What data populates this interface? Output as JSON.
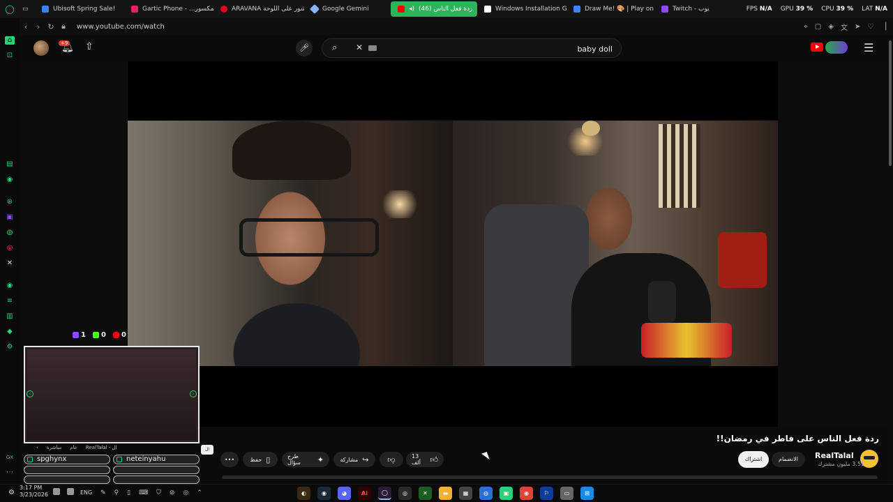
{
  "browser": {
    "tabs": [
      {
        "label": "Ubisoft Spring Sale!",
        "color": "#3b82f6"
      },
      {
        "label": "Gartic Phone - ...لف المكسور",
        "color": "#e91e63"
      },
      {
        "label": "ARAVANA منشور على اللوحة",
        "color": "#e60023"
      },
      {
        "label": "Google Gemini",
        "color": "#8ab4f8"
      },
      {
        "label": "(46) ردة فعل الناس",
        "color": "#ff0000",
        "active": true
      },
      {
        "label": "Windows Installation Guid",
        "color": "#ffffff"
      },
      {
        "label": "Draw Me! 🎨 | Play on Rob",
        "color": "#3b82f6"
      },
      {
        "label": "Twitch - يوب",
        "color": "#9146ff"
      }
    ],
    "url": "www.youtube.com/watch",
    "stats": {
      "fps_label": "FPS",
      "fps_value": "N/A",
      "gpu_label": "GPU",
      "gpu_value": "39 %",
      "cpu_label": "CPU",
      "cpu_value": "39 %",
      "lat_label": "LAT",
      "lat_value": "N/A"
    }
  },
  "youtube": {
    "notification_count": "+9",
    "search_value": "baby doll",
    "video_title": "ردة فعل الناس على فاطر في رمضان!!",
    "channel_name": "RealTalal",
    "channel_subs": "3.51 مليون مشترك",
    "join_label": "الانضمام",
    "subscribe_label": "اشتراك",
    "like_count": "13 ألف",
    "share_label": "مشاركة",
    "ask_label": "طرح سؤال",
    "save_label": "حفظ",
    "more_label": "•••"
  },
  "overlay": {
    "counters": [
      {
        "icon": "twitch-icon",
        "value": "1",
        "color": "#9146ff"
      },
      {
        "icon": "kick-icon",
        "value": "0",
        "color": "#53fc18"
      },
      {
        "icon": "youtube-icon",
        "value": "0",
        "color": "#ff0000"
      }
    ],
    "chat_users": [
      "spghynx",
      "neteinyahu"
    ],
    "chat_header": [
      "مباشرة",
      "عام",
      "RealTalal - ال"
    ]
  },
  "taskbar": {
    "time": "3:17 PM",
    "date": "3/23/2026",
    "lang": "ENG"
  }
}
